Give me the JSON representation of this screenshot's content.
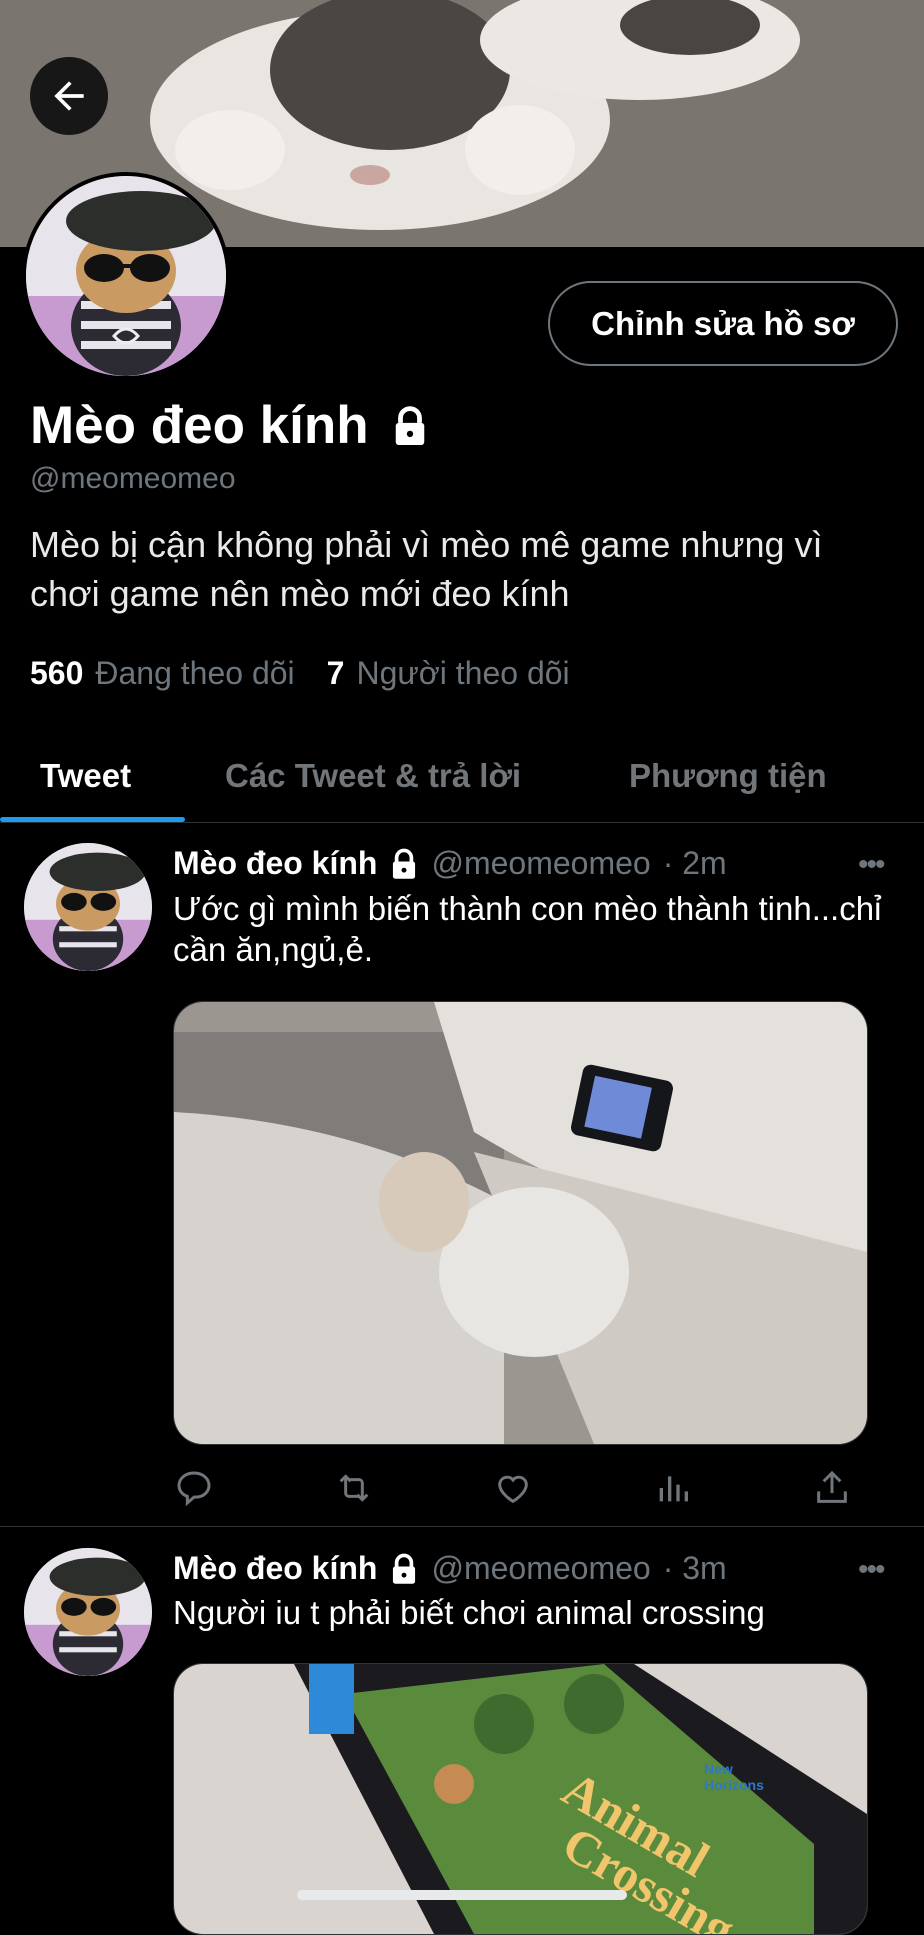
{
  "profile": {
    "name": "Mèo đeo kính",
    "handle": "@meomeomeo",
    "bio": "Mèo bị cận không phải vì mèo mê game nhưng vì chơi game nên mèo mới đeo kính",
    "following_count": "560",
    "following_label": "Đang theo dõi",
    "followers_count": "7",
    "followers_label": "Người theo dõi",
    "edit_button": "Chỉnh sửa hồ sơ"
  },
  "tabs": [
    {
      "label": "Tweet",
      "active": true
    },
    {
      "label": "Các Tweet & trả lời",
      "active": false
    },
    {
      "label": "Phương tiện",
      "active": false
    }
  ],
  "tweets": [
    {
      "name": "Mèo đeo kính",
      "handle": "@meomeomeo",
      "time": "· 2m",
      "text": "Ước gì mình biến thành con mèo thành tinh...chỉ cần ăn,ngủ,ẻ."
    },
    {
      "name": "Mèo đeo kính",
      "handle": "@meomeomeo",
      "time": "· 3m",
      "text": "Người iu t phải biết chơi animal crossing",
      "media_text": {
        "title_line1": "Animal",
        "title_line2": "Crossing",
        "badge_line1": "New",
        "badge_line2": "Horizons"
      }
    }
  ],
  "icons": {
    "back": "arrow-left-icon",
    "lock": "lock-icon",
    "more": "more-icon",
    "reply": "reply-icon",
    "retweet": "retweet-icon",
    "like": "heart-icon",
    "views": "analytics-icon",
    "share": "share-icon"
  },
  "colors": {
    "accent": "#1d9bf0",
    "muted": "#6e767d",
    "background": "#000000"
  }
}
